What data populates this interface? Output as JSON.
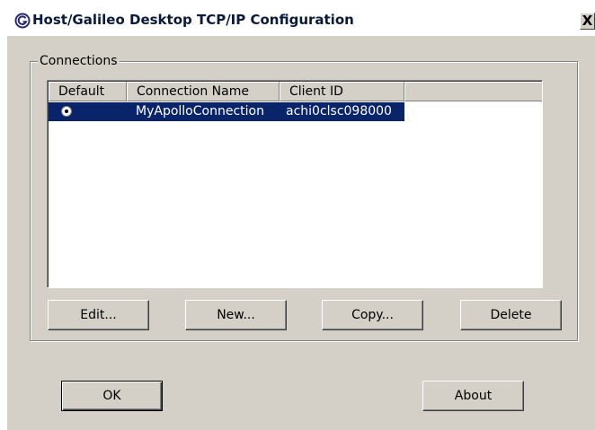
{
  "window": {
    "title": "Host/Galileo Desktop TCP/IP Configuration",
    "app_icon": "galileo-logo-icon",
    "close_label": "X"
  },
  "connections": {
    "group_label": "Connections",
    "columns": [
      "Default",
      "Connection Name",
      "Client ID"
    ],
    "rows": [
      {
        "default_selected": true,
        "name": "MyApolloConnection",
        "client_id": "achi0clsc098000"
      }
    ],
    "selection_color": "#0a246a"
  },
  "buttons": {
    "edit": "Edit...",
    "new": "New...",
    "copy": "Copy...",
    "delete": "Delete",
    "ok": "OK",
    "about": "About"
  }
}
